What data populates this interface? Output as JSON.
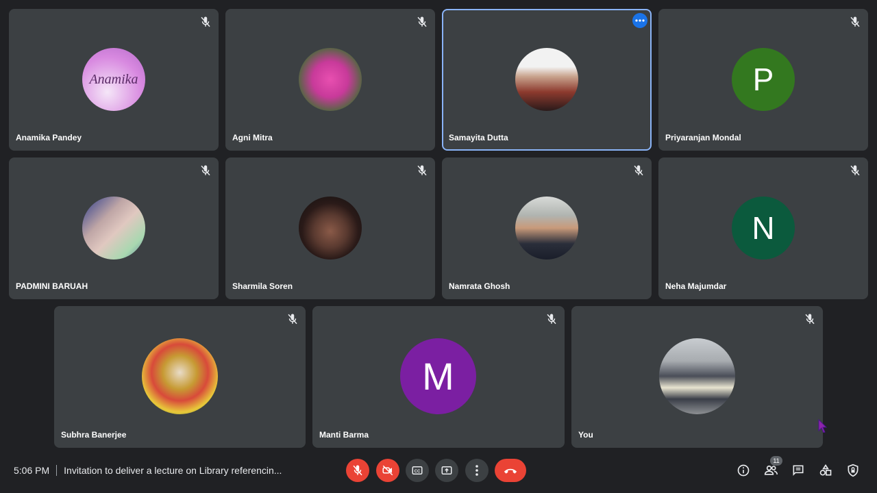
{
  "participants": [
    {
      "name": "Anamika Pandey",
      "avatar_text": "Anamika",
      "avatar_color": "#d889e0"
    },
    {
      "name": "Agni Mitra",
      "avatar_color": "#c83a9a"
    },
    {
      "name": "Samayita Dutta",
      "avatar_color": "#8c3a2e",
      "active": true
    },
    {
      "name": "Priyaranjan Mondal",
      "avatar_letter": "P",
      "avatar_color": "#33781f"
    },
    {
      "name": "PADMINI BARUAH",
      "avatar_color": "#bfa6a6"
    },
    {
      "name": "Sharmila Soren",
      "avatar_color": "#2a1a18"
    },
    {
      "name": "Namrata Ghosh",
      "avatar_color": "#7d7f88"
    },
    {
      "name": "Neha Majumdar",
      "avatar_letter": "N",
      "avatar_color": "#0b5a3d"
    },
    {
      "name": "Subhra Banerjee",
      "avatar_color": "#c79a33"
    },
    {
      "name": "Manti Barma",
      "avatar_letter": "M",
      "avatar_color": "#7b1fa2"
    },
    {
      "name": "You",
      "avatar_color": "#8d9093"
    }
  ],
  "bottom_bar": {
    "time": "5:06 PM",
    "meeting_title": "Invitation to deliver a lecture on Library referencin...",
    "participants_count": "11"
  },
  "icons": {
    "mute": "mic-off-icon",
    "more": "more-options-icon",
    "mic": "mic-off-icon",
    "camera": "camera-off-icon",
    "captions": "captions-icon",
    "present": "present-screen-icon",
    "more_vert": "more-vert-icon",
    "end_call": "end-call-icon",
    "info": "info-icon",
    "people": "people-icon",
    "chat": "chat-icon",
    "activities": "activities-icon",
    "host_controls": "host-controls-icon"
  },
  "colors": {
    "background": "#202124",
    "tile": "#3c4043",
    "active_border": "#8ab4f8",
    "danger": "#ea4335"
  }
}
